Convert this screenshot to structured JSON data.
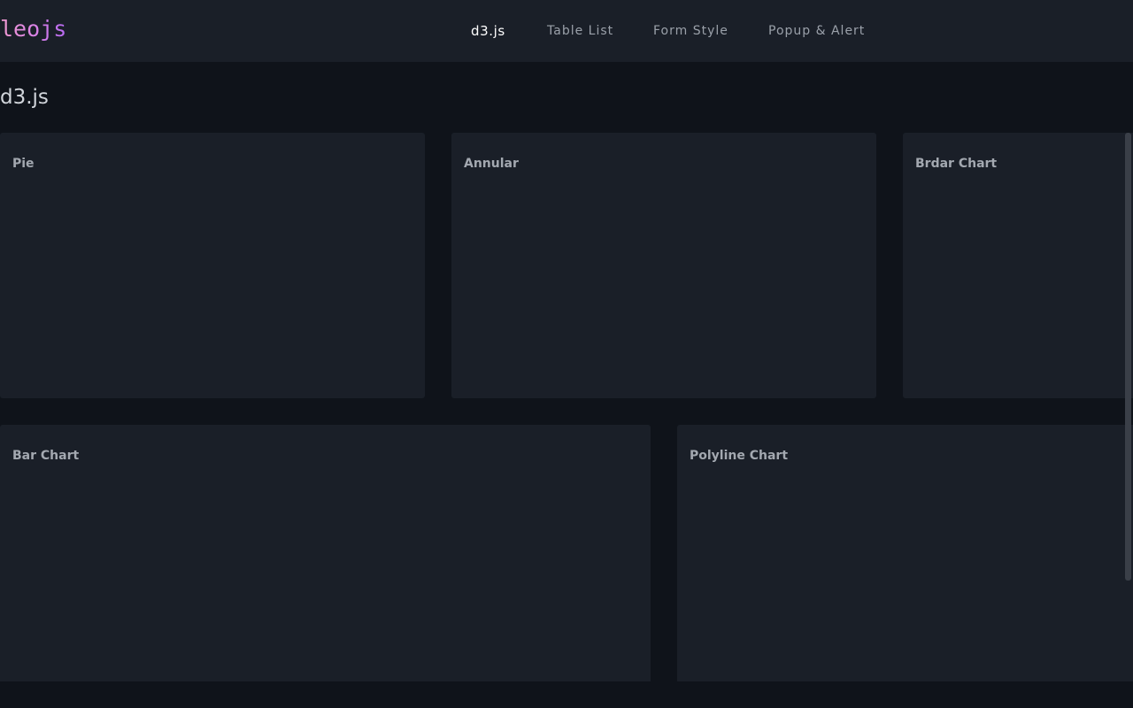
{
  "app": {
    "logo": "leojs"
  },
  "nav": {
    "items": [
      {
        "label": "d3.js",
        "active": true
      },
      {
        "label": "Table List",
        "active": false
      },
      {
        "label": "Form Style",
        "active": false
      },
      {
        "label": "Popup & Alert",
        "active": false
      }
    ]
  },
  "page": {
    "title": "d3.js"
  },
  "cards": {
    "pie": {
      "title": "Pie"
    },
    "annular": {
      "title": "Annular"
    },
    "brdar": {
      "title": "Brdar Chart"
    },
    "bar": {
      "title": "Bar Chart"
    },
    "polyline": {
      "title": "Polyline Chart"
    }
  },
  "colors": {
    "background": "#0f131a",
    "panel": "#1a1f28",
    "logo_gradient_start": "#f09ad0",
    "logo_gradient_end": "#b76af2",
    "nav_active": "#ffffff",
    "nav_inactive": "#9aa0a9",
    "card_title": "#a3a8b0"
  }
}
